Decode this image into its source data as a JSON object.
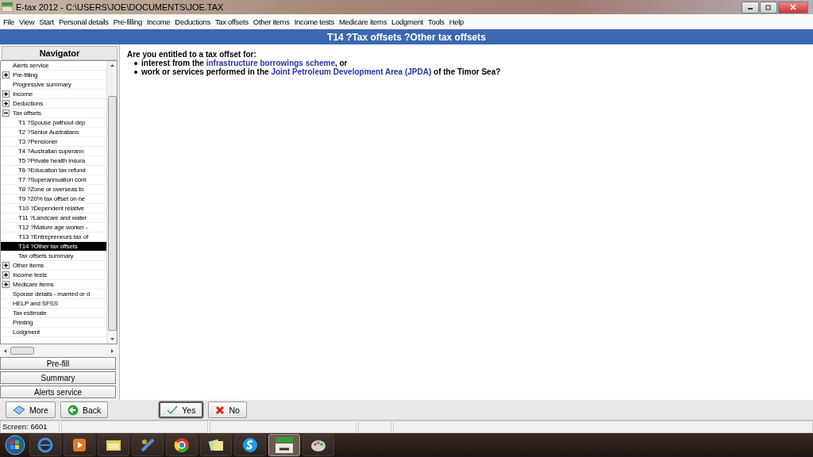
{
  "window": {
    "title": "E-tax 2012 - C:\\USERS\\JOE\\DOCUMENTS\\JOE.TAX"
  },
  "menu": [
    "File",
    "View",
    "Start",
    "Personal details",
    "Pre-filling",
    "Income",
    "Deductions",
    "Tax offsets",
    "Other items",
    "Income tests",
    "Medicare items",
    "Lodgment",
    "Tools",
    "Help"
  ],
  "header": {
    "title": "T14 ?Tax offsets ?Other tax offsets"
  },
  "navigator": {
    "title": "Navigator",
    "items": [
      {
        "label": "Alerts service",
        "selected": false
      },
      {
        "label": "Pre-filling",
        "expanded": false,
        "selected": false
      },
      {
        "label": "Progressive summary",
        "selected": false
      },
      {
        "label": "Income",
        "expanded": false,
        "selected": false
      },
      {
        "label": "Deductions",
        "expanded": false,
        "selected": false
      },
      {
        "label": "Tax offsets",
        "expanded": true,
        "selected": false,
        "children": [
          {
            "label": "T1 ?Spouse (without dep",
            "selected": false
          },
          {
            "label": "T2 ?Senior Australians",
            "selected": false
          },
          {
            "label": "T3 ?Pensioner",
            "selected": false
          },
          {
            "label": "T4 ?Australian superann",
            "selected": false
          },
          {
            "label": "T5 ?Private health insura",
            "selected": false
          },
          {
            "label": "T6 ?Education tax refund",
            "selected": false
          },
          {
            "label": "T7 ?Superannuation cont",
            "selected": false
          },
          {
            "label": "T8 ?Zone or overseas fo",
            "selected": false
          },
          {
            "label": "T9 ?20% tax offset on ne",
            "selected": false
          },
          {
            "label": "T10 ?Dependent relative",
            "selected": false
          },
          {
            "label": "T11 ?Landcare and water",
            "selected": false
          },
          {
            "label": "T12 ?Mature age worker -",
            "selected": false
          },
          {
            "label": "T13 ?Entrepreneurs tax of",
            "selected": false
          },
          {
            "label": "T14 ?Other tax offsets",
            "selected": true
          },
          {
            "label": "Tax offsets summary",
            "selected": false
          }
        ]
      },
      {
        "label": "Other items",
        "expanded": false,
        "selected": false
      },
      {
        "label": "Income tests",
        "expanded": false,
        "selected": false
      },
      {
        "label": "Medicare items",
        "expanded": false,
        "selected": false
      },
      {
        "label": "Spouse details - married or d",
        "selected": false
      },
      {
        "label": "HELP and SFSS",
        "selected": false
      },
      {
        "label": "Tax estimate",
        "selected": false
      },
      {
        "label": "Printing",
        "selected": false
      },
      {
        "label": "Lodgment",
        "selected": false
      }
    ],
    "buttons": [
      "Pre-fill",
      "Summary",
      "Alerts service"
    ]
  },
  "question": {
    "text": "Are you entitled to a tax offset for:",
    "bullets": [
      [
        {
          "kind": "plain",
          "text": "interest from the "
        },
        {
          "kind": "link",
          "text": "infrastructure borrowings scheme"
        },
        {
          "kind": "plain",
          "text": ", or"
        }
      ],
      [
        {
          "kind": "plain",
          "text": "work or services performed in the "
        },
        {
          "kind": "link",
          "text": "Joint Petroleum Development Area (JPDA)"
        },
        {
          "kind": "plain",
          "text": " of the Timor Sea?"
        }
      ]
    ]
  },
  "buttons": [
    {
      "kind": "more",
      "label": "More",
      "default": false
    },
    {
      "kind": "back",
      "label": "Back",
      "default": false
    },
    {
      "kind": "yes",
      "label": "Yes",
      "default": true
    },
    {
      "kind": "no",
      "label": "No",
      "default": false
    }
  ],
  "status_bar": {
    "screen": "Screen: 6601"
  },
  "taskbar": [
    {
      "kind": "browser",
      "selected": false
    },
    {
      "kind": "media",
      "selected": false
    },
    {
      "kind": "folder",
      "selected": false
    },
    {
      "kind": "tool",
      "selected": false
    },
    {
      "kind": "chrome",
      "selected": false
    },
    {
      "kind": "notes",
      "selected": false
    },
    {
      "kind": "chat",
      "selected": false
    },
    {
      "kind": "etax",
      "selected": true
    },
    {
      "kind": "paint",
      "selected": false
    }
  ]
}
